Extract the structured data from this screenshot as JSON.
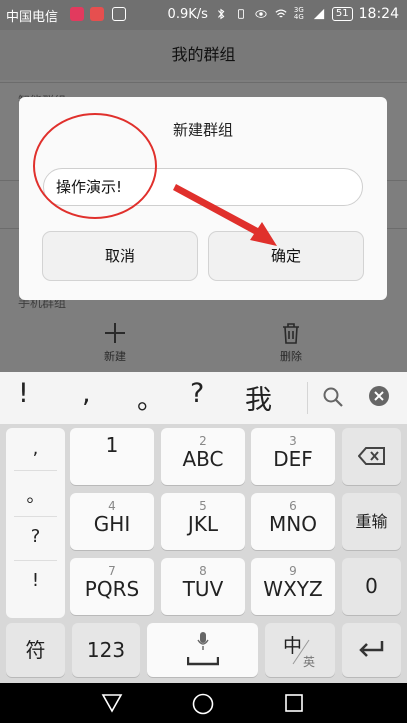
{
  "status_bar": {
    "carrier": "中国电信",
    "speed": "0.9K/s",
    "signal_label": "3G 4G",
    "battery": "51",
    "time": "18:24"
  },
  "header": {
    "title": "我的群组"
  },
  "list": {
    "item_top": "智能群组",
    "item_bottom": "手机群组"
  },
  "toolbar": {
    "new_label": "新建",
    "delete_label": "删除"
  },
  "dialog": {
    "title": "新建群组",
    "input_value": "操作演示!",
    "cancel_label": "取消",
    "confirm_label": "确定",
    "annotation_color": "#e0302c"
  },
  "keyboard": {
    "candidates": [
      "!",
      ",",
      "。",
      "?",
      "我"
    ],
    "symbols": [
      ",",
      "。",
      "?",
      "!"
    ],
    "keys": [
      {
        "num": "",
        "letters": "1"
      },
      {
        "num": "2",
        "letters": "ABC"
      },
      {
        "num": "3",
        "letters": "DEF"
      },
      {
        "num": "4",
        "letters": "GHI"
      },
      {
        "num": "5",
        "letters": "JKL"
      },
      {
        "num": "6",
        "letters": "MNO"
      },
      {
        "num": "7",
        "letters": "PQRS"
      },
      {
        "num": "8",
        "letters": "TUV"
      },
      {
        "num": "9",
        "letters": "WXYZ"
      }
    ],
    "reenter_label": "重输",
    "zero_label": "0",
    "symbol_key_label": "符",
    "num_key_label": "123",
    "lang_key_main": "中",
    "lang_key_sub": "英"
  }
}
